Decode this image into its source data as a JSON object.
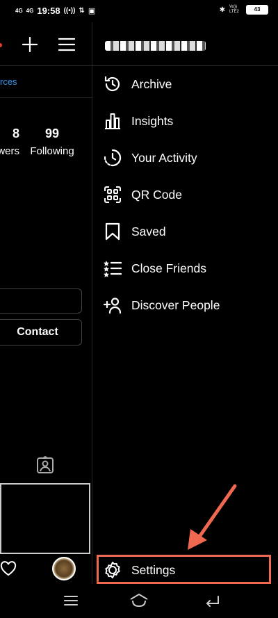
{
  "status_bar": {
    "network_1": "4G",
    "network_2": "4G",
    "time": "19:58",
    "volte": "Vo)) LTE2",
    "battery": "43"
  },
  "profile": {
    "resources_link": "rces",
    "followers_count": "8",
    "followers_label": "wers",
    "following_count": "99",
    "following_label": "Following",
    "contact_button": "Contact"
  },
  "drawer": {
    "username": "[obscured]",
    "items": [
      {
        "label": "Archive",
        "icon": "archive-icon"
      },
      {
        "label": "Insights",
        "icon": "insights-icon"
      },
      {
        "label": "Your Activity",
        "icon": "activity-icon"
      },
      {
        "label": "QR Code",
        "icon": "qr-code-icon"
      },
      {
        "label": "Saved",
        "icon": "bookmark-icon"
      },
      {
        "label": "Close Friends",
        "icon": "close-friends-icon"
      },
      {
        "label": "Discover People",
        "icon": "add-person-icon"
      }
    ],
    "settings_label": "Settings"
  },
  "colors": {
    "accent_link": "#3797f0",
    "annotation": "#ee6950",
    "background": "#000000",
    "divider": "#262626"
  }
}
